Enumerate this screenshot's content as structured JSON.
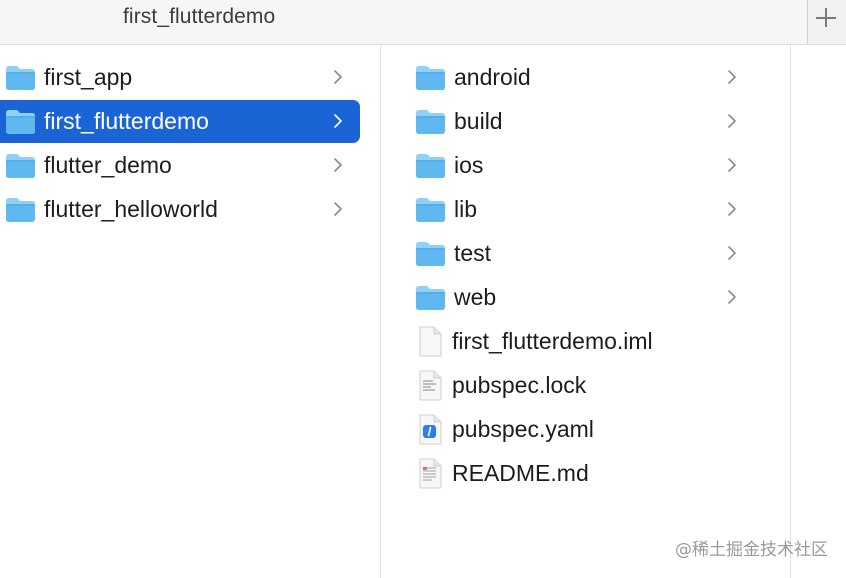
{
  "tab": {
    "title": "first_flutterdemo"
  },
  "column1": {
    "items": [
      {
        "label": "first_app",
        "icon": "folder-icon",
        "has_children": true,
        "selected": false
      },
      {
        "label": "first_flutterdemo",
        "icon": "folder-icon",
        "has_children": true,
        "selected": true
      },
      {
        "label": "flutter_demo",
        "icon": "folder-icon",
        "has_children": true,
        "selected": false
      },
      {
        "label": "flutter_helloworld",
        "icon": "folder-icon",
        "has_children": true,
        "selected": false
      }
    ]
  },
  "column2": {
    "items": [
      {
        "label": "android",
        "icon": "folder-icon",
        "has_children": true
      },
      {
        "label": "build",
        "icon": "folder-icon",
        "has_children": true
      },
      {
        "label": "ios",
        "icon": "folder-icon",
        "has_children": true
      },
      {
        "label": "lib",
        "icon": "folder-icon",
        "has_children": true
      },
      {
        "label": "test",
        "icon": "folder-icon",
        "has_children": true
      },
      {
        "label": "web",
        "icon": "folder-icon",
        "has_children": true
      },
      {
        "label": "first_flutterdemo.iml",
        "icon": "blank-file-icon",
        "has_children": false
      },
      {
        "label": "pubspec.lock",
        "icon": "text-file-icon",
        "has_children": false
      },
      {
        "label": "pubspec.yaml",
        "icon": "yaml-file-icon",
        "has_children": false
      },
      {
        "label": "README.md",
        "icon": "markdown-file-icon",
        "has_children": false
      }
    ]
  },
  "watermark": "@稀土掘金技术社区",
  "colors": {
    "selection": "#1a64d6",
    "folder_top": "#8fd0f7",
    "folder_body": "#5fb8ef"
  }
}
